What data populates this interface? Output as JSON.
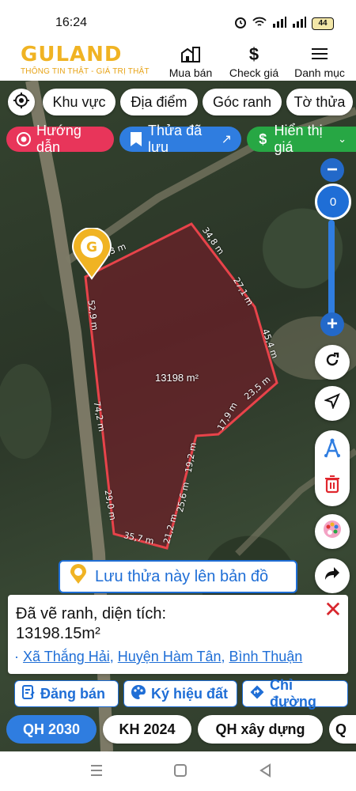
{
  "status_bar": {
    "time": "16:24",
    "battery": "44"
  },
  "header": {
    "logo_word": "GULAND",
    "logo_tagline": "THÔNG TIN THẬT - GIÁ TRỊ THẬT",
    "nav": [
      {
        "label": "Mua bán",
        "icon": "house-building-icon"
      },
      {
        "label": "Check giá",
        "icon": "dollar-icon"
      },
      {
        "label": "Danh mục",
        "icon": "hamburger-menu-icon"
      }
    ]
  },
  "filters": {
    "items": [
      "Khu vực",
      "Địa điểm",
      "Góc ranh",
      "Tờ thửa"
    ]
  },
  "quick_actions": [
    {
      "label": "Hướng dẫn",
      "color": "#e8355a"
    },
    {
      "label": "Thửa đã lưu",
      "color": "#2f7de0"
    },
    {
      "label": "Hiển thị giá",
      "color": "#27a744"
    }
  ],
  "zoom": {
    "level": "0"
  },
  "parcel": {
    "area_label": "13198 m²",
    "dimensions": [
      "4,3 m",
      "34,8 m",
      "27,1 m",
      "45,4 m",
      "23,5 m",
      "17,9 m",
      "19,2 m",
      "25,6 m",
      "21,2 m",
      "35,7 m",
      "29,0 m",
      "74,2 m",
      "52,9 m"
    ]
  },
  "save_parcel": {
    "label": "Lưu thửa này lên bản đồ"
  },
  "info": {
    "message_line1": "Đã vẽ ranh, diện tích:",
    "message_line2": "13198.15m²",
    "commune": "Xã Thắng Hải",
    "district": "Huyện Hàm Tân",
    "province": "Bình Thuận",
    "separator": ", "
  },
  "actions": [
    {
      "label": "Đăng bán",
      "icon": "post-icon"
    },
    {
      "label": "Ký hiệu đất",
      "icon": "palette-icon"
    },
    {
      "label": "Chỉ đường",
      "icon": "directions-icon"
    }
  ],
  "tabs": [
    {
      "label": "QH 2030",
      "active": true
    },
    {
      "label": "KH 2024",
      "active": false
    },
    {
      "label": "QH xây dựng",
      "active": false
    },
    {
      "label": "Q",
      "active": false
    }
  ],
  "colors": {
    "brand": "#f0b323",
    "primary": "#2f7de0",
    "parcel_border": "#e8434a"
  }
}
